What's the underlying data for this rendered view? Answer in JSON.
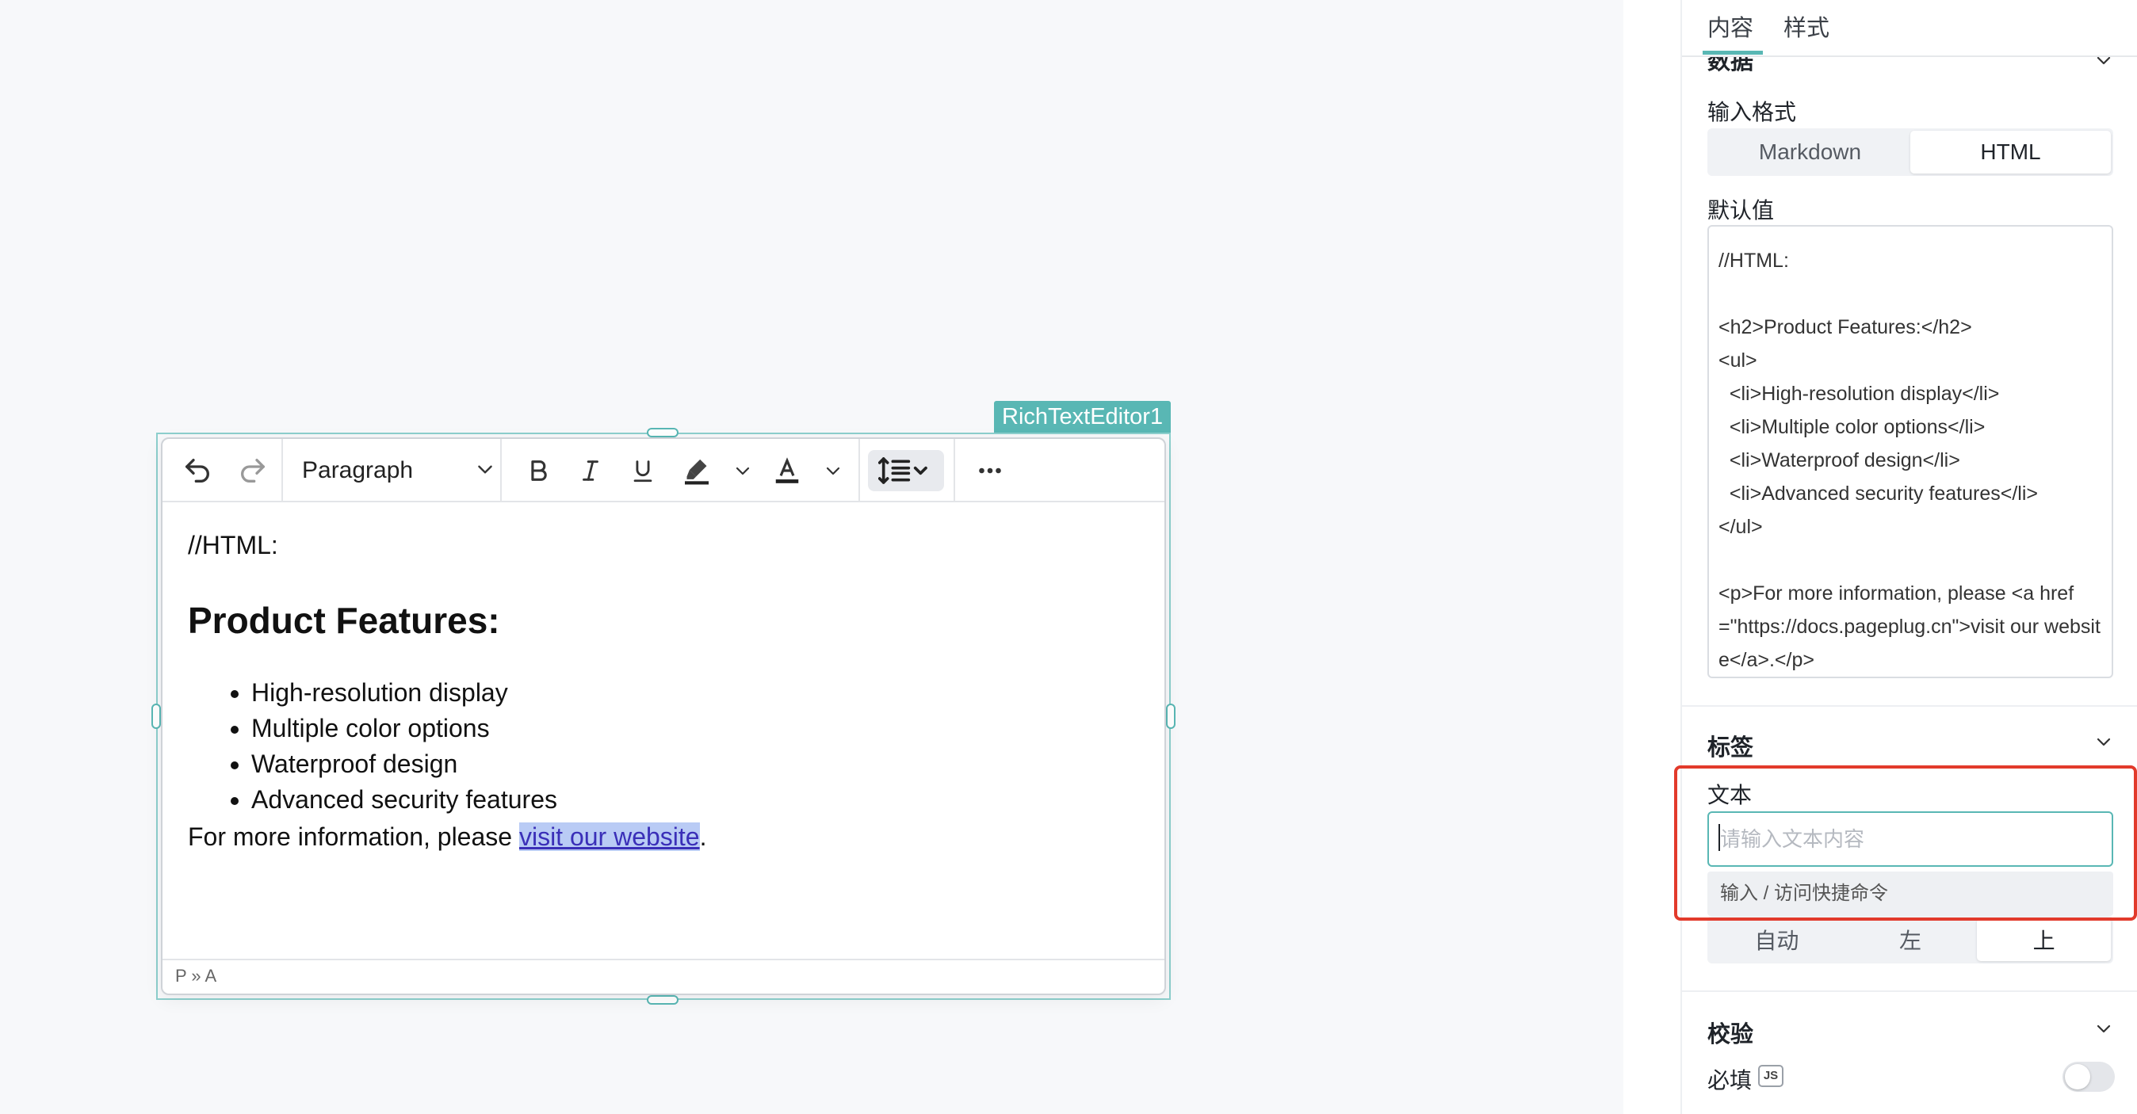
{
  "widget": {
    "tag": "RichTextEditor1"
  },
  "toolbar": {
    "block_format": "Paragraph",
    "buttons": [
      "undo-icon",
      "redo-icon",
      "bold-icon",
      "italic-icon",
      "underline-icon",
      "highlight-icon",
      "font-color-icon",
      "line-height-icon",
      "more-icon"
    ]
  },
  "content": {
    "comment": "//HTML:",
    "heading": "Product Features:",
    "list": [
      "High-resolution display",
      "Multiple color options",
      "Waterproof design",
      "Advanced security features"
    ],
    "para_prefix": "For more information, please ",
    "link_text": "visit our website",
    "para_suffix": "."
  },
  "statusbar": {
    "path": "P » A"
  },
  "panel": {
    "tabs": [
      "内容",
      "样式"
    ],
    "data_section": {
      "title": "数据"
    },
    "input_format": {
      "label": "输入格式",
      "options": [
        "Markdown",
        "HTML"
      ],
      "selected": "HTML"
    },
    "default_value": {
      "label": "默认值",
      "text": "//HTML:\n\n<h2>Product Features:</h2>\n<ul>\n  <li>High-resolution display</li>\n  <li>Multiple color options</li>\n  <li>Waterproof design</li>\n  <li>Advanced security features</li>\n</ul>\n\n<p>For more information, please <a href=\"https://docs.pageplug.cn\">visit our website</a>.</p>"
    },
    "label_section": {
      "title": "标签",
      "text_label": "文本",
      "text_placeholder": "请输入文本内容",
      "hint": "输入 / 访问快捷命令",
      "position_options": [
        "自动",
        "左",
        "上"
      ],
      "position_selected": "上"
    },
    "validation_section": {
      "title": "校验",
      "required_label": "必填",
      "js_badge": "JS",
      "required": false
    }
  },
  "colors": {
    "accent": "#59b7b4",
    "highlight_border": "#e23a2b",
    "link": "#3a2fb8",
    "link_bg": "#b9cbf5"
  }
}
